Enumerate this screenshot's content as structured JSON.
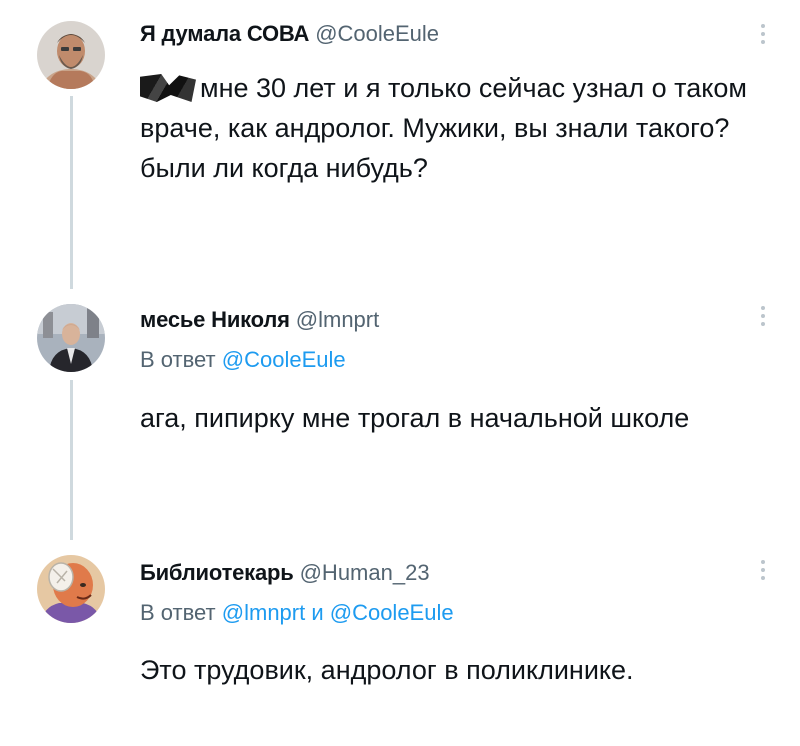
{
  "tweets": [
    {
      "author_name": "Я думала СОВА",
      "author_handle": "@CooleEule",
      "text": "мне 30 лет и я только сейчас узнал о таком враче, как андролог. Мужики, вы знали такого? были ли когда нибудь?",
      "avatar_icon": "user-avatar-bearded-man"
    },
    {
      "author_name": "месье Николя",
      "author_handle": "@lmnprt",
      "reply_prefix": "В ответ",
      "reply_mentions": "@CooleEule",
      "text": "ага, пипирку мне трогал в начальной школе",
      "avatar_icon": "user-avatar-man-in-suit"
    },
    {
      "author_name": "Библиотекарь",
      "author_handle": "@Human_23",
      "reply_prefix": "В ответ",
      "reply_mentions": "@lmnprt и @CooleEule",
      "text": "Это трудовик, андролог в поликлинике.",
      "avatar_icon": "user-avatar-cartoon-character"
    }
  ],
  "colors": {
    "text": "#0f1419",
    "secondary": "#536471",
    "accent": "#1d9bf0",
    "thread_line": "#cfd9de"
  }
}
